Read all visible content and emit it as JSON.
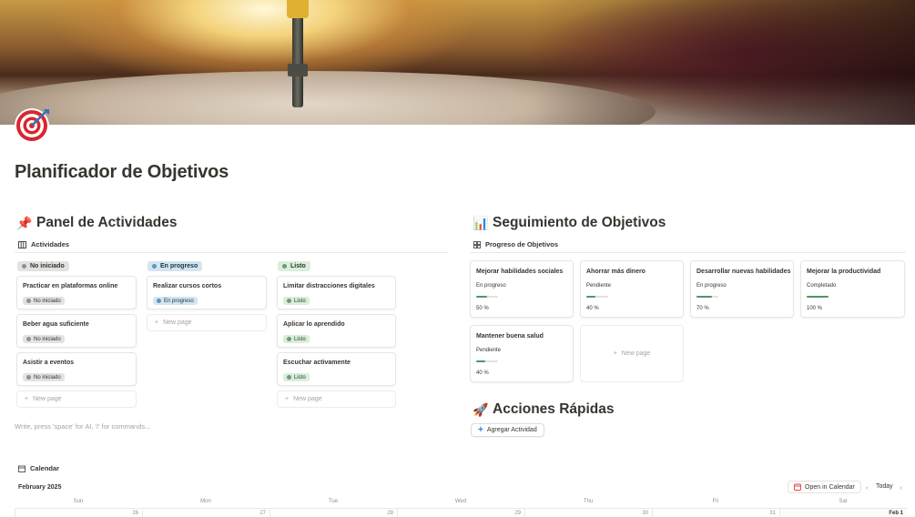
{
  "page": {
    "title": "Planificador de Objetivos",
    "icon": "dart-target-icon"
  },
  "actividades": {
    "heading": "Panel de Actividades",
    "heading_icon": "pushpin-icon",
    "view_label": "Actividades",
    "groups": [
      {
        "label": "No iniciado",
        "color": "gray",
        "cards": [
          {
            "title": "Practicar en plataformas online",
            "status": "No iniciado"
          },
          {
            "title": "Beber agua suficiente",
            "status": "No iniciado"
          },
          {
            "title": "Asistir a eventos",
            "status": "No iniciado"
          }
        ]
      },
      {
        "label": "En progreso",
        "color": "blue",
        "cards": [
          {
            "title": "Realizar cursos cortos",
            "status": "En progreso"
          }
        ]
      },
      {
        "label": "Listo",
        "color": "green",
        "cards": [
          {
            "title": "Limitar distracciones digitales",
            "status": "Listo"
          },
          {
            "title": "Aplicar lo aprendido",
            "status": "Listo"
          },
          {
            "title": "Escuchar activamente",
            "status": "Listo"
          }
        ]
      }
    ],
    "new_page_label": "New page"
  },
  "editor_hint": "Write, press 'space' for AI, '/' for commands...",
  "seguimiento": {
    "heading": "Seguimiento de Objetivos",
    "heading_icon": "bar-chart-icon",
    "view_label": "Progreso de Objetivos",
    "goals": [
      {
        "title": "Mejorar habilidades sociales",
        "status": "En progreso",
        "progress": 0.5,
        "progress_label": "50 %"
      },
      {
        "title": "Ahorrar más dinero",
        "status": "Pendiente",
        "progress": 0.4,
        "progress_label": "40 %"
      },
      {
        "title": "Desarrollar nuevas habilidades",
        "status": "En progreso",
        "progress": 0.7,
        "progress_label": "70 %"
      },
      {
        "title": "Mejorar la productividad",
        "status": "Completado",
        "progress": 1.0,
        "progress_label": "100 %"
      },
      {
        "title": "Mantener buena salud",
        "status": "Pendiente",
        "progress": 0.4,
        "progress_label": "40 %"
      }
    ],
    "new_page_label": "New page"
  },
  "acciones": {
    "heading": "Acciones Rápidas",
    "heading_icon": "rocket-icon",
    "button_label": "Agregar Actividad"
  },
  "calendar": {
    "view_label": "Calendar",
    "month": "February 2025",
    "open_label": "Open in Calendar",
    "today_label": "Today",
    "weekdays": [
      "Sun",
      "Mon",
      "Tue",
      "Wed",
      "Thu",
      "Fri",
      "Sat"
    ],
    "first_row_days": [
      "26",
      "27",
      "28",
      "29",
      "30",
      "31",
      "Feb 1"
    ]
  },
  "colors": {
    "accent": "#2383e2",
    "progress": "#4f9768"
  }
}
